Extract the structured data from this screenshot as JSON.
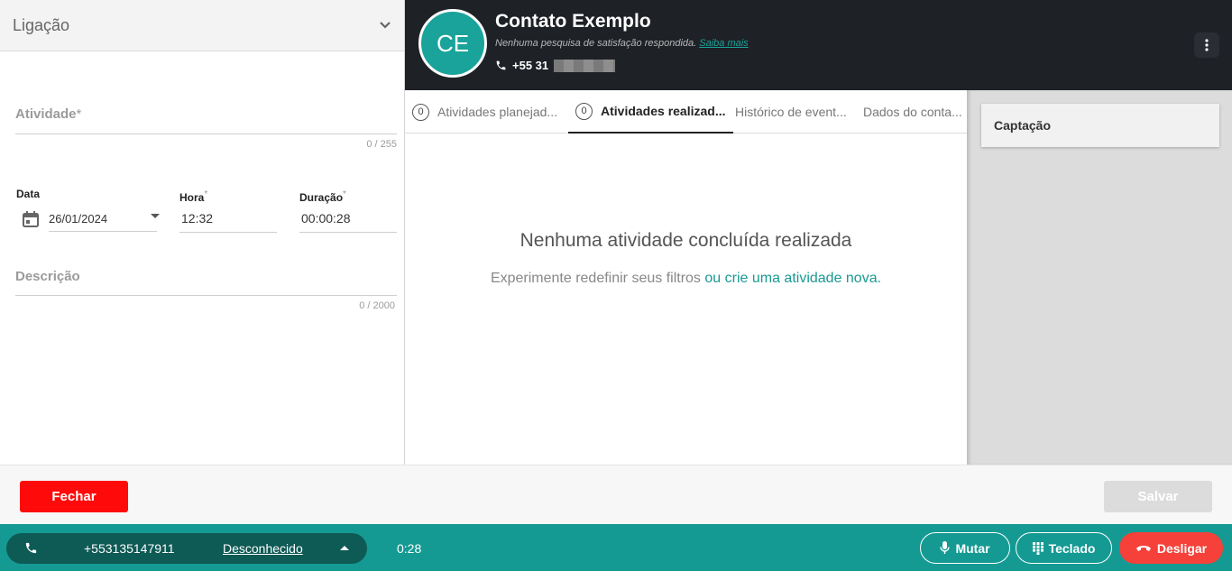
{
  "left_panel": {
    "title": "Ligação",
    "activity_label": "Atividade",
    "activity_required": "*",
    "activity_counter": "0 / 255",
    "date_label": "Data",
    "date_value": "26/01/2024",
    "time_label": "Hora",
    "time_required": "*",
    "time_value": "12:32",
    "duration_label": "Duração",
    "duration_required": "*",
    "duration_value": "00:00:28",
    "description_label": "Descrição",
    "description_counter": "0 / 2000"
  },
  "contact": {
    "initials": "CE",
    "name": "Contato Exemplo",
    "survey_text": "Nenhuma pesquisa de satisfação respondida.",
    "survey_link": "Saiba mais",
    "phone_prefix": "+55 31",
    "avatar_color": "#1aa39a"
  },
  "tabs": [
    {
      "count": "0",
      "label": "Atividades planejad..."
    },
    {
      "count": "0",
      "label": "Atividades realizad..."
    },
    {
      "label": "Histórico de event..."
    },
    {
      "label": "Dados do conta..."
    }
  ],
  "empty_state": {
    "title": "Nenhuma atividade concluída realizada",
    "subtitle": "Experimente redefinir seus filtros",
    "link": "ou crie uma atividade nova."
  },
  "right_panel": {
    "card_title": "Captação"
  },
  "footer": {
    "close_label": "Fechar",
    "save_label": "Salvar"
  },
  "call_bar": {
    "number": "+553135147911",
    "status": "Desconhecido",
    "timer": "0:28",
    "mute_label": "Mutar",
    "keypad_label": "Teclado",
    "hangup_label": "Desligar",
    "accent_color": "#149a93",
    "hangup_color": "#f5413a"
  }
}
